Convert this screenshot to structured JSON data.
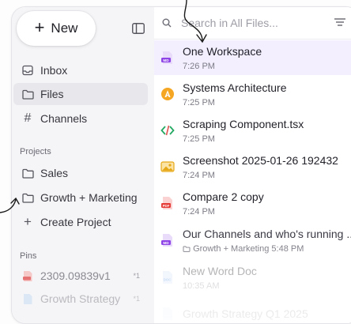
{
  "sidebar": {
    "new_label": "New",
    "nav": [
      {
        "label": "Inbox",
        "icon": "inbox-icon"
      },
      {
        "label": "Files",
        "icon": "folder-icon"
      },
      {
        "label": "Channels",
        "icon": "hash-icon"
      }
    ],
    "projects_label": "Projects",
    "projects": [
      {
        "label": "Sales"
      },
      {
        "label": "Growth + Marketing"
      }
    ],
    "create_project_label": "Create Project",
    "pins_label": "Pins",
    "pins": [
      {
        "label": "2309.09839v1",
        "count": "*1"
      },
      {
        "label": "Growth Strategy",
        "count": "*1"
      }
    ]
  },
  "main": {
    "search_placeholder": "Search in All Files...",
    "files": [
      {
        "name": "One Workspace",
        "time": "7:26 PM",
        "type": "md",
        "color": "#8e44e6"
      },
      {
        "name": "Systems Architecture",
        "time": "7:25 PM",
        "type": "orange",
        "color": "#f39c12"
      },
      {
        "name": "Scraping Component.tsx",
        "time": "7:25 PM",
        "type": "code",
        "color": "#20b060"
      },
      {
        "name": "Screenshot 2025-01-26 192432",
        "time": "7:24 PM",
        "type": "image",
        "color": "#e6a817"
      },
      {
        "name": "Compare 2 copy",
        "time": "7:24 PM",
        "type": "pdf",
        "color": "#e53935"
      },
      {
        "name": "Our Channels and who's running ...",
        "time": "5:48 PM",
        "folder": "Growth + Marketing",
        "type": "md",
        "color": "#8e44e6"
      },
      {
        "name": "New Word Doc",
        "time": "10:35 AM",
        "type": "doc",
        "color": "#2f7de1"
      },
      {
        "name": "Growth Strategy Q1 2025",
        "time": "",
        "type": "doc",
        "color": "#2f7de1"
      }
    ]
  },
  "colors": {
    "accent": "#8e44e6",
    "selected_row": "#f3efff",
    "active_nav": "#e8e8ec"
  }
}
